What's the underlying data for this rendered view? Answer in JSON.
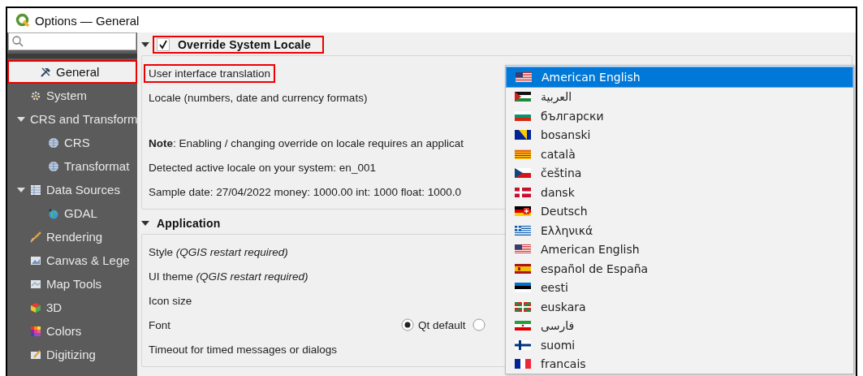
{
  "window": {
    "title": "Options — General"
  },
  "sidebar": {
    "items": [
      {
        "label": "General",
        "selected": true,
        "highlighted": true
      },
      {
        "label": "System",
        "selected": false,
        "highlighted": false
      },
      {
        "label": "CRS and Transform",
        "selected": false,
        "highlighted": false,
        "expanded": true,
        "children": [
          {
            "label": "CRS",
            "selected": false,
            "highlighted": false
          },
          {
            "label": "Transformat",
            "selected": false,
            "highlighted": false
          }
        ]
      },
      {
        "label": "Data Sources",
        "selected": false,
        "highlighted": false,
        "expanded": true,
        "children": [
          {
            "label": "GDAL",
            "selected": false,
            "highlighted": false
          }
        ]
      },
      {
        "label": "Rendering",
        "selected": false,
        "highlighted": false
      },
      {
        "label": "Canvas & Lege",
        "selected": false,
        "highlighted": false
      },
      {
        "label": "Map Tools",
        "selected": false,
        "highlighted": false
      },
      {
        "label": "3D",
        "selected": false,
        "highlighted": false
      },
      {
        "label": "Colors",
        "selected": false,
        "highlighted": false
      },
      {
        "label": "Digitizing",
        "selected": false,
        "highlighted": false
      }
    ]
  },
  "sections": [
    {
      "title": "Override System Locale",
      "expanded": true,
      "checked": true,
      "highlighted": true,
      "rows": [
        {
          "kind": "label",
          "text": "User interface translation",
          "highlighted": true
        },
        {
          "kind": "label",
          "text": "Locale (numbers, date and currency formats)",
          "highlighted": false
        },
        {
          "kind": "gap"
        },
        {
          "kind": "label",
          "text": "**Note**: Enabling / changing override on locale requires an applicat",
          "highlighted": false
        },
        {
          "kind": "label",
          "text": "Detected active locale on your system: en_001",
          "highlighted": false
        },
        {
          "kind": "label",
          "text": "Sample date: 27/04/2022 money: 1000.00 int: 1000 float: 1000.0",
          "highlighted": false
        }
      ]
    },
    {
      "title": "Application",
      "expanded": true,
      "highlighted": false,
      "rows": [
        {
          "kind": "label",
          "text": "Style *(QGIS restart required)*",
          "highlighted": false
        },
        {
          "kind": "label",
          "text": "UI theme *(QGIS restart required)*",
          "highlighted": false
        },
        {
          "kind": "label",
          "text": "Icon size",
          "highlighted": false
        },
        {
          "kind": "radio",
          "text": "Font",
          "highlighted": false,
          "options": [
            {
              "label": "Qt default",
              "selected": true
            },
            {
              "selected": false
            }
          ]
        },
        {
          "kind": "label",
          "text": "Timeout for timed messages or dialogs",
          "highlighted": false
        }
      ]
    }
  ],
  "dropdown": {
    "items": [
      {
        "label": "American English",
        "selected": true
      },
      {
        "label": "العربية",
        "selected": false
      },
      {
        "label": "български",
        "selected": false
      },
      {
        "label": "bosanski",
        "selected": false
      },
      {
        "label": "català",
        "selected": false
      },
      {
        "label": "čeština",
        "selected": false
      },
      {
        "label": "dansk",
        "selected": false
      },
      {
        "label": "Deutsch",
        "selected": false
      },
      {
        "label": "Ελληνικά",
        "selected": false
      },
      {
        "label": "American English",
        "selected": false
      },
      {
        "label": "español de España",
        "selected": false
      },
      {
        "label": "eesti",
        "selected": false
      },
      {
        "label": "euskara",
        "selected": false
      },
      {
        "label": "فارسی",
        "selected": false
      },
      {
        "label": "suomi",
        "selected": false
      },
      {
        "label": "francais",
        "selected": false
      }
    ]
  }
}
